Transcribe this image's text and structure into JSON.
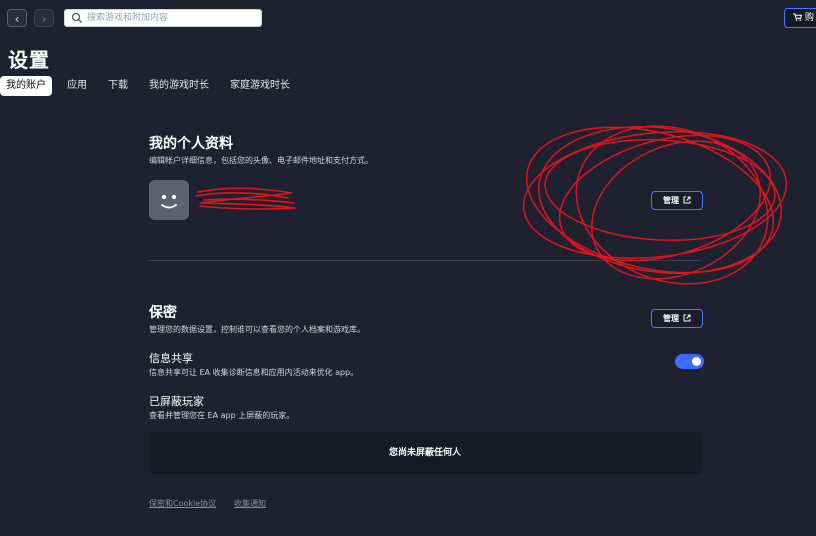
{
  "topbar": {
    "back_icon": "chevron-left-icon",
    "forward_icon": "chevron-right-icon",
    "search_placeholder": "搜索游戏和附加内容",
    "store_label": "购"
  },
  "page": {
    "title": "设置"
  },
  "tabs": [
    {
      "label": "我的账户",
      "active": true
    },
    {
      "label": "应用",
      "active": false
    },
    {
      "label": "下载",
      "active": false
    },
    {
      "label": "我的游戏时长",
      "active": false
    },
    {
      "label": "家庭游戏时长",
      "active": false
    }
  ],
  "profile": {
    "title": "我的个人资料",
    "description": "编辑帐户详细信息，包括您的头像、电子邮件地址和支付方式。",
    "manage_label": "管理"
  },
  "privacy": {
    "title": "保密",
    "description": "管理您的数据设置，控制谁可以查看您的个人档案和游戏库。",
    "manage_label": "管理"
  },
  "info_sharing": {
    "title": "信息共享",
    "description": "信息共享可让 EA 收集诊断信息和应用内活动来优化 app。",
    "enabled": true
  },
  "blocked": {
    "title": "已屏蔽玩家",
    "description": "查看并管理您在 EA app 上屏蔽的玩家。",
    "empty_text": "您尚未屏蔽任何人"
  },
  "footer": {
    "privacy_link": "保密和Cookie协议",
    "notice_link": "收集通知"
  },
  "colors": {
    "background": "#1e2130",
    "accent": "#4a7bff",
    "annotation": "#e0141c"
  }
}
